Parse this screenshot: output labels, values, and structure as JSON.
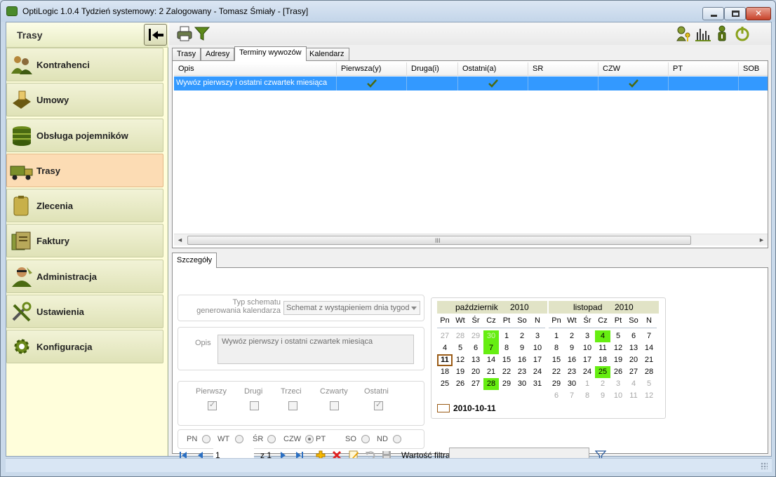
{
  "window": {
    "title": "OptiLogic 1.0.4  Tydzień systemowy: 2  Zalogowany - Tomasz Śmiały - [Trasy]"
  },
  "sidebar": {
    "title": "Trasy",
    "items": [
      {
        "label": "Kontrahenci",
        "icon": "people-icon"
      },
      {
        "label": "Umowy",
        "icon": "contract-icon"
      },
      {
        "label": "Obsługa pojemników",
        "icon": "containers-icon"
      },
      {
        "label": "Trasy",
        "icon": "truck-icon",
        "active": true
      },
      {
        "label": "Zlecenia",
        "icon": "order-icon"
      },
      {
        "label": "Faktury",
        "icon": "invoice-icon"
      },
      {
        "label": "Administracja",
        "icon": "admin-icon"
      },
      {
        "label": "Ustawienia",
        "icon": "tools-icon"
      },
      {
        "label": "Konfiguracja",
        "icon": "gear-icon"
      }
    ]
  },
  "top_tabs": [
    "Trasy",
    "Adresy",
    "Terminy wywozów",
    "Kalendarz"
  ],
  "active_top_tab": "Terminy wywozów",
  "grid": {
    "columns": [
      "Opis",
      "Pierwsza(y)",
      "Druga(i)",
      "Ostatni(a)",
      "SR",
      "CZW",
      "PT",
      "SOB"
    ],
    "rows": [
      {
        "opis": "Wywóz pierwszy i ostatni czwartek miesiąca",
        "pierwsza": true,
        "druga": false,
        "ostatni": true,
        "sr": false,
        "czw": true,
        "pt": false,
        "sob": false
      }
    ],
    "scroll_grip": "III"
  },
  "bottom_tabs": [
    "Szczegóły"
  ],
  "details": {
    "schema_label_line1": "Typ schematu",
    "schema_label_line2": "generowania kalendarza",
    "schema_value": "Schemat z wystąpieniem dnia tygod",
    "opis_label": "Opis",
    "opis_value": "Wywóz pierwszy i ostatni czwartek miesiąca",
    "occurrence": {
      "labels": [
        "Pierwszy",
        "Drugi",
        "Trzeci",
        "Czwarty",
        "Ostatni"
      ],
      "checked": [
        true,
        false,
        false,
        false,
        true
      ]
    },
    "days": {
      "labels": [
        "PN",
        "WT",
        "ŚR",
        "CZW",
        "PT",
        "SO",
        "ND"
      ],
      "selected": "CZW"
    }
  },
  "calendar": {
    "weekdays": [
      "Pn",
      "Wt",
      "Śr",
      "Cz",
      "Pt",
      "So",
      "N"
    ],
    "months": [
      {
        "name": "październik",
        "year": "2010",
        "weeks": [
          [
            [
              "27",
              "g"
            ],
            [
              "28",
              "g"
            ],
            [
              "29",
              "g"
            ],
            [
              "30",
              "gG"
            ],
            [
              "1",
              ""
            ],
            [
              "2",
              ""
            ],
            [
              "3",
              ""
            ]
          ],
          [
            [
              "4",
              ""
            ],
            [
              "5",
              ""
            ],
            [
              "6",
              ""
            ],
            [
              "7",
              "G"
            ],
            [
              "8",
              ""
            ],
            [
              "9",
              ""
            ],
            [
              "10",
              ""
            ]
          ],
          [
            [
              "11",
              "t"
            ],
            [
              "12",
              ""
            ],
            [
              "13",
              ""
            ],
            [
              "14",
              ""
            ],
            [
              "15",
              ""
            ],
            [
              "16",
              ""
            ],
            [
              "17",
              ""
            ]
          ],
          [
            [
              "18",
              ""
            ],
            [
              "19",
              ""
            ],
            [
              "20",
              ""
            ],
            [
              "21",
              ""
            ],
            [
              "22",
              ""
            ],
            [
              "23",
              ""
            ],
            [
              "24",
              ""
            ]
          ],
          [
            [
              "25",
              ""
            ],
            [
              "26",
              ""
            ],
            [
              "27",
              ""
            ],
            [
              "28",
              "G"
            ],
            [
              "29",
              ""
            ],
            [
              "30",
              ""
            ],
            [
              "31",
              ""
            ]
          ]
        ]
      },
      {
        "name": "listopad",
        "year": "2010",
        "weeks": [
          [
            [
              "1",
              ""
            ],
            [
              "2",
              ""
            ],
            [
              "3",
              ""
            ],
            [
              "4",
              "G"
            ],
            [
              "5",
              ""
            ],
            [
              "6",
              ""
            ],
            [
              "7",
              ""
            ]
          ],
          [
            [
              "8",
              ""
            ],
            [
              "9",
              ""
            ],
            [
              "10",
              ""
            ],
            [
              "11",
              ""
            ],
            [
              "12",
              ""
            ],
            [
              "13",
              ""
            ],
            [
              "14",
              ""
            ]
          ],
          [
            [
              "15",
              ""
            ],
            [
              "16",
              ""
            ],
            [
              "17",
              ""
            ],
            [
              "18",
              ""
            ],
            [
              "19",
              ""
            ],
            [
              "20",
              ""
            ],
            [
              "21",
              ""
            ]
          ],
          [
            [
              "22",
              ""
            ],
            [
              "23",
              ""
            ],
            [
              "24",
              ""
            ],
            [
              "25",
              "G"
            ],
            [
              "26",
              ""
            ],
            [
              "27",
              ""
            ],
            [
              "28",
              ""
            ]
          ],
          [
            [
              "29",
              ""
            ],
            [
              "30",
              ""
            ],
            [
              "1",
              "g"
            ],
            [
              "2",
              "g"
            ],
            [
              "3",
              "g"
            ],
            [
              "4",
              "g"
            ],
            [
              "5",
              "g"
            ]
          ],
          [
            [
              "6",
              "g"
            ],
            [
              "7",
              "g"
            ],
            [
              "8",
              "g"
            ],
            [
              "9",
              "g"
            ],
            [
              "10",
              "g"
            ],
            [
              "11",
              "g"
            ],
            [
              "12",
              "g"
            ]
          ]
        ]
      }
    ],
    "today": "2010-10-11"
  },
  "navigator": {
    "page_value": "1",
    "page_of": "z 1",
    "filter_label": "Wartość filtra",
    "filter_value": ""
  },
  "colors": {
    "highlight": "#66ee11",
    "selection": "#3399ff",
    "sidebar_active": "#fcdcb4"
  }
}
